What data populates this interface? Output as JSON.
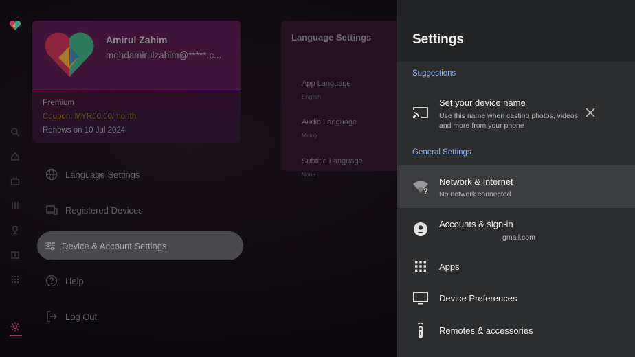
{
  "profile": {
    "name": "Amirul Zahim",
    "email": "mohdamirulzahim@*****.c...",
    "plan": "Premium",
    "coupon": "Coupon: MYR00.00/month",
    "renews": "Renews on 10 Jul 2024"
  },
  "language_card": {
    "title": "Language Settings",
    "items": [
      {
        "label": "App Language",
        "value": "English"
      },
      {
        "label": "Audio Language",
        "value": "Malay"
      },
      {
        "label": "Subtitle Language",
        "value": "None"
      }
    ]
  },
  "menu": {
    "items": [
      {
        "label": "Language Settings",
        "icon": "globe-icon"
      },
      {
        "label": "Registered Devices",
        "icon": "devices-icon"
      },
      {
        "label": "Device & Account Settings",
        "icon": "sliders-icon"
      },
      {
        "label": "Help",
        "icon": "help-icon"
      },
      {
        "label": "Log Out",
        "icon": "logout-icon"
      }
    ]
  },
  "settings_panel": {
    "title": "Settings",
    "suggestions_header": "Suggestions",
    "suggestion": {
      "title": "Set your device name",
      "subtitle_line1": "Use this name when casting photos, videos,",
      "subtitle_line2": "and more from your phone"
    },
    "general_header": "General Settings",
    "items": [
      {
        "title": "Network & Internet",
        "subtitle": "No network connected",
        "icon": "wifi-unknown-icon"
      },
      {
        "title": "Accounts & sign-in",
        "subtitle": "gmail.com",
        "icon": "account-circle-icon"
      },
      {
        "title": "Apps",
        "subtitle": "",
        "icon": "apps-grid-icon"
      },
      {
        "title": "Device Preferences",
        "subtitle": "",
        "icon": "tv-icon"
      },
      {
        "title": "Remotes & accessories",
        "subtitle": "",
        "icon": "remote-icon"
      }
    ]
  },
  "colors": {
    "accent": "#8ab4f8",
    "panel_bg": "#2b2d2f",
    "brand_pink": "#a5325e"
  }
}
